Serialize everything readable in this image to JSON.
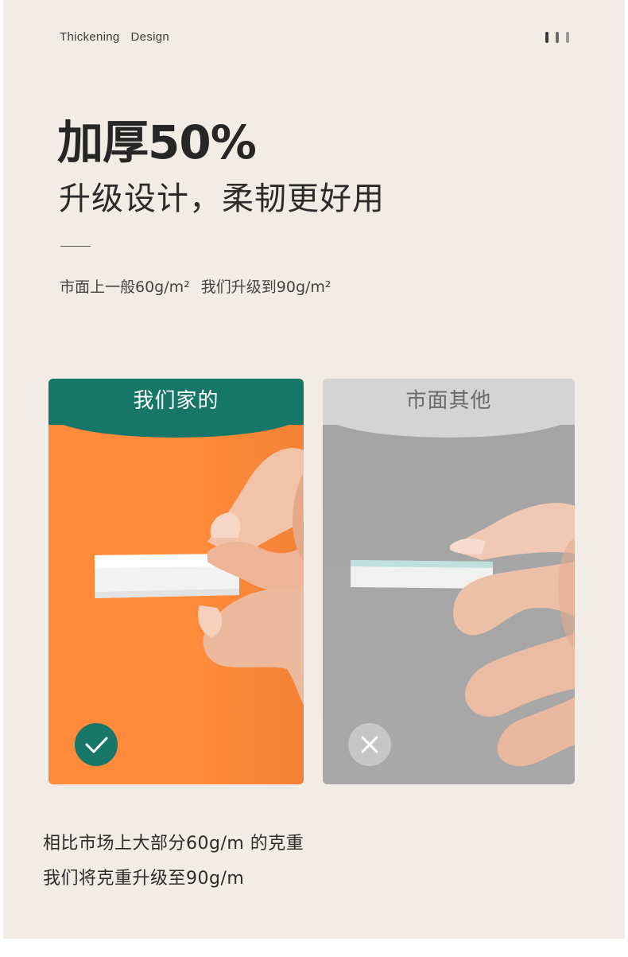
{
  "header": {
    "word_1": "Thickening",
    "word_2": "Design"
  },
  "headline": "加厚50%",
  "subheadline": "升级设计，柔韧更好用",
  "spec": {
    "market": "市面上一般60g/m²",
    "ours": "我们升级到90g/m²"
  },
  "comparison": {
    "ours": {
      "label": "我们家的",
      "badge_icon": "check-icon",
      "background_color": "#ff8a3a",
      "header_color": "#167768"
    },
    "other": {
      "label": "市面其他",
      "badge_icon": "cross-icon",
      "background_color": "#a3a3a3",
      "header_color": "#d4d4d4"
    }
  },
  "footer": {
    "line_1": "相比市场上大部分60g/m 的克重",
    "line_2": "我们将克重升级至90g/m"
  }
}
